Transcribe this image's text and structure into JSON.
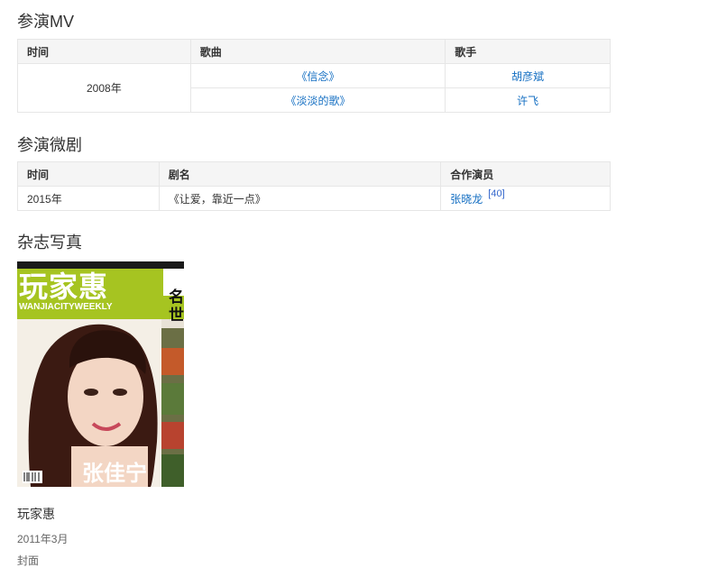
{
  "mv_section": {
    "heading": "参演MV",
    "headers": [
      "时间",
      "歌曲",
      "歌手"
    ],
    "year": "2008年",
    "rows": [
      {
        "song": "《信念》",
        "singer": "胡彦斌"
      },
      {
        "song": "《淡淡的歌》",
        "singer": "许飞"
      }
    ]
  },
  "drama_section": {
    "heading": "参演微剧",
    "headers": [
      "时间",
      "剧名",
      "合作演员"
    ],
    "row": {
      "year": "2015年",
      "title": "《让爱，靠近一点》",
      "actor": "张晓龙",
      "ref": "[40]"
    }
  },
  "magazine_section": {
    "heading": "杂志写真",
    "cover": {
      "masthead": "玩家惠",
      "masthead_sub": "WANJIACITYWEEKLY",
      "side_text": "名\n世",
      "name_text": "张佳宁"
    },
    "caption": "玩家惠",
    "date": "2011年3月",
    "type": "封面"
  }
}
